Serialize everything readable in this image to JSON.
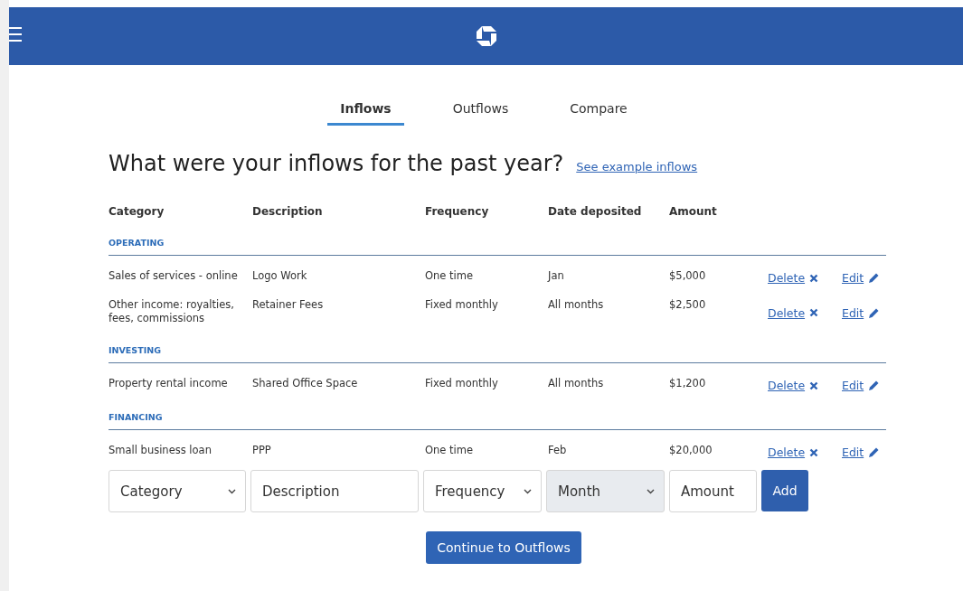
{
  "tabs": [
    {
      "label": "Inflows",
      "selected": true
    },
    {
      "label": "Outflows",
      "selected": false
    },
    {
      "label": "Compare",
      "selected": false
    }
  ],
  "heading": "What were your inflows for the past year?",
  "example_link": "See example inflows",
  "table": {
    "columns": [
      "Category",
      "Description",
      "Frequency",
      "Date deposited",
      "Amount"
    ],
    "sections": [
      {
        "title": "OPERATING",
        "rows": [
          {
            "category": "Sales of services - online",
            "description": "Logo Work",
            "frequency": "One time",
            "date": "Jan",
            "amount": "$5,000",
            "delete": "Delete",
            "edit": "Edit"
          },
          {
            "category": "Other income: royalties, fees, commissions",
            "description": "Retainer Fees",
            "frequency": "Fixed monthly",
            "date": "All months",
            "amount": "$2,500",
            "delete": "Delete",
            "edit": "Edit"
          }
        ]
      },
      {
        "title": "INVESTING",
        "rows": [
          {
            "category": "Property rental income",
            "description": "Shared Office Space",
            "frequency": "Fixed monthly",
            "date": "All months",
            "amount": "$1,200",
            "delete": "Delete",
            "edit": "Edit"
          }
        ]
      },
      {
        "title": "FINANCING",
        "rows": [
          {
            "category": "Small business loan",
            "description": "PPP",
            "frequency": "One time",
            "date": "Feb",
            "amount": "$20,000",
            "delete": "Delete",
            "edit": "Edit"
          }
        ]
      }
    ]
  },
  "form": {
    "fields": [
      {
        "kind": "select",
        "placeholder": "Category",
        "disabled": false
      },
      {
        "kind": "input",
        "placeholder": "Description",
        "disabled": false
      },
      {
        "kind": "select",
        "placeholder": "Frequency",
        "disabled": false
      },
      {
        "kind": "select",
        "placeholder": "Month",
        "disabled": true
      },
      {
        "kind": "input",
        "placeholder": "Amount",
        "disabled": false
      }
    ],
    "add_button": "Add"
  },
  "continue_button": "Continue to Outflows"
}
